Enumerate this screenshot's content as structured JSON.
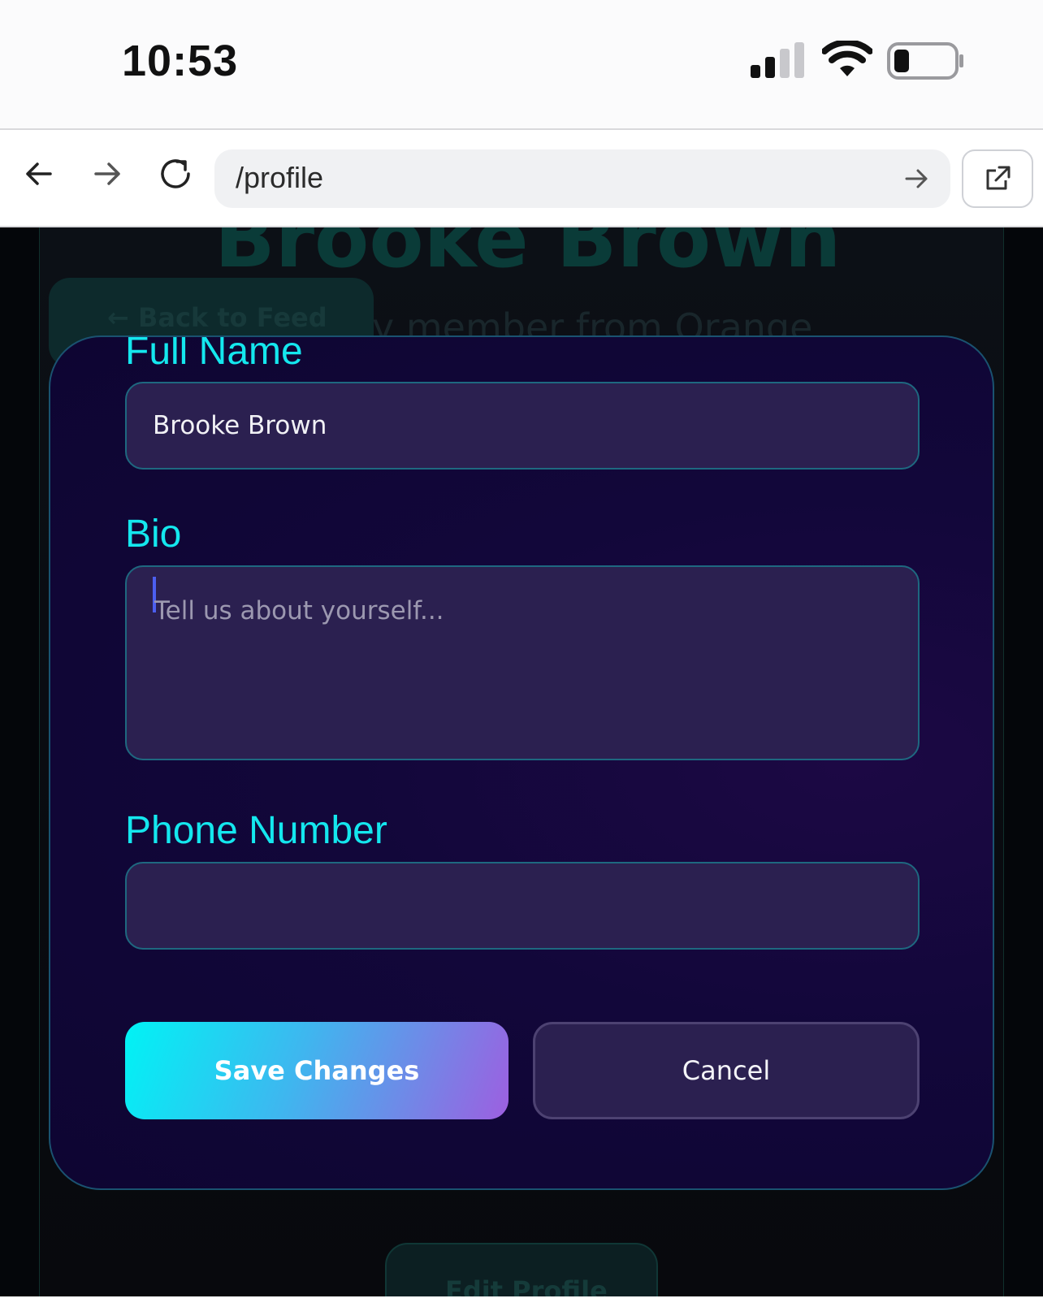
{
  "status_bar": {
    "time": "10:53",
    "icons": [
      "cellular-signal-icon",
      "wifi-icon",
      "battery-icon"
    ]
  },
  "browser": {
    "url": "/profile",
    "icons": [
      "back-arrow-icon",
      "forward-arrow-icon",
      "reload-icon",
      "go-arrow-icon",
      "open-external-icon"
    ]
  },
  "background_page": {
    "title": "Brooke Brown",
    "back_button_label": "Back to Feed",
    "subtitle_fragment": "y member from Orange",
    "edit_profile_label": "Edit Profile"
  },
  "modal": {
    "full_name": {
      "label": "Full Name",
      "value": "Brooke Brown"
    },
    "bio": {
      "label": "Bio",
      "value": "",
      "placeholder": "Tell us about yourself..."
    },
    "phone": {
      "label": "Phone Number",
      "value": ""
    },
    "save_label": "Save Changes",
    "cancel_label": "Cancel"
  },
  "colors": {
    "accent_cyan": "#14e7ee",
    "modal_bg": "#12073a",
    "input_bg": "#2b2050",
    "save_gradient_start": "#00f3f5",
    "save_gradient_end": "#9d5fe0"
  }
}
